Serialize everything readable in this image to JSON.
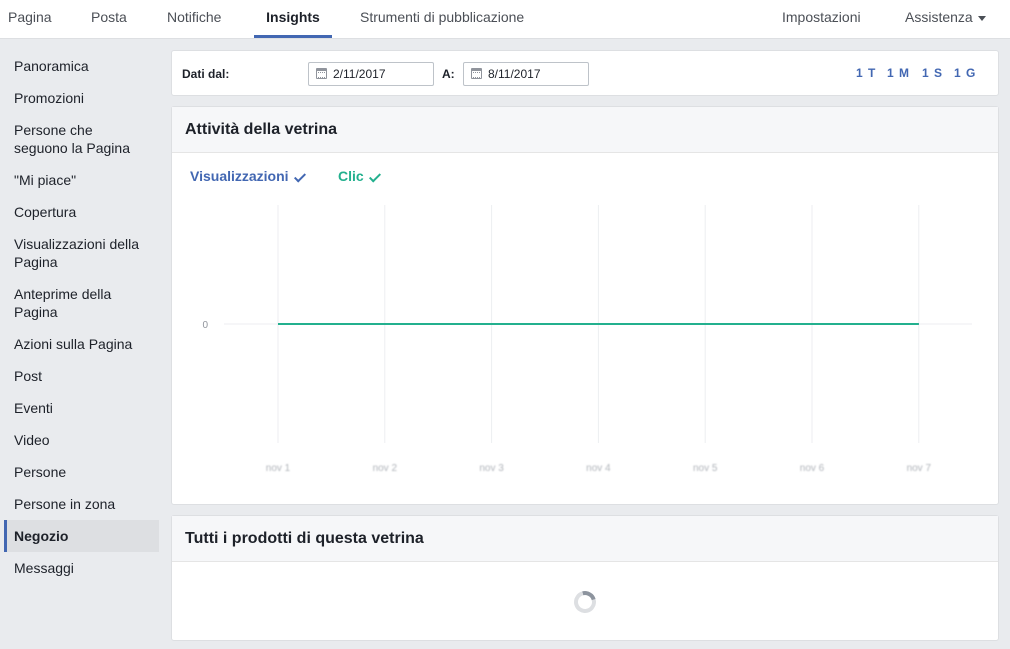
{
  "topnav": {
    "tabs": [
      {
        "label": "Pagina"
      },
      {
        "label": "Posta"
      },
      {
        "label": "Notifiche"
      },
      {
        "label": "Insights",
        "active": true
      },
      {
        "label": "Strumenti di pubblicazione"
      }
    ],
    "settings_label": "Impostazioni",
    "help_label": "Assistenza"
  },
  "sidebar": {
    "items": [
      {
        "label": "Panoramica"
      },
      {
        "label": "Promozioni"
      },
      {
        "label": "Persone che seguono la Pagina"
      },
      {
        "label": "\"Mi piace\""
      },
      {
        "label": "Copertura"
      },
      {
        "label": "Visualizzazioni della Pagina"
      },
      {
        "label": "Anteprime della Pagina"
      },
      {
        "label": "Azioni sulla Pagina"
      },
      {
        "label": "Post"
      },
      {
        "label": "Eventi"
      },
      {
        "label": "Video"
      },
      {
        "label": "Persone"
      },
      {
        "label": "Persone in zona"
      },
      {
        "label": "Negozio",
        "active": true
      },
      {
        "label": "Messaggi"
      }
    ]
  },
  "daterange": {
    "from_label": "Dati dal:",
    "from_value": "2/11/2017",
    "to_label": "A:",
    "to_value": "8/11/2017",
    "ranges": [
      "1 T",
      "1 M",
      "1 S",
      "1 G"
    ]
  },
  "activity": {
    "title": "Attività della vetrina",
    "legend": [
      {
        "label": "Visualizzazioni",
        "color": "#4267b2"
      },
      {
        "label": "Clic",
        "color": "#23b08e"
      }
    ]
  },
  "chart_data": {
    "type": "line",
    "categories": [
      "nov 1",
      "nov 2",
      "nov 3",
      "nov 4",
      "nov 5",
      "nov 6",
      "nov 7"
    ],
    "series": [
      {
        "name": "Visualizzazioni",
        "values": [
          0,
          0,
          0,
          0,
          0,
          0,
          0
        ],
        "color": "#4267b2"
      },
      {
        "name": "Clic",
        "values": [
          0,
          0,
          0,
          0,
          0,
          0,
          0
        ],
        "color": "#23b08e"
      }
    ],
    "yticks": [
      0
    ],
    "grid": true
  },
  "products": {
    "title": "Tutti i prodotti di questa vetrina"
  }
}
